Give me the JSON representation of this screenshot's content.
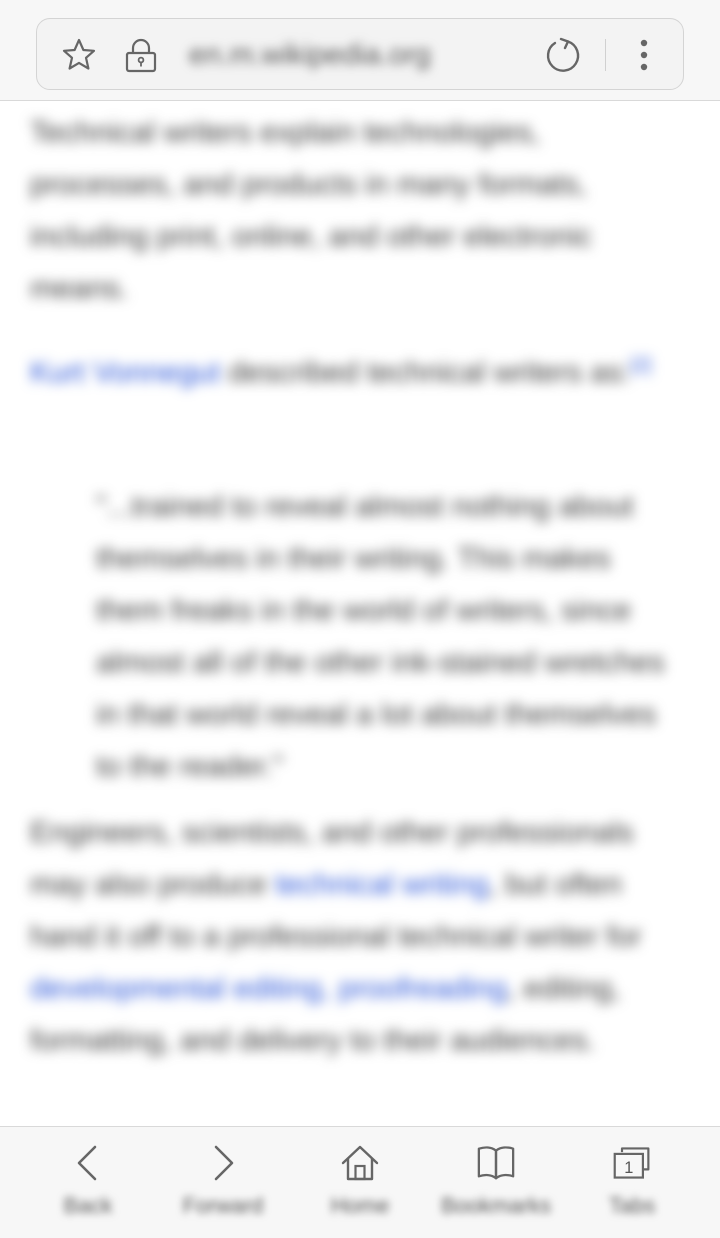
{
  "browser": {
    "url": "en.m.wikipedia.org"
  },
  "icons": {
    "star": "star-icon",
    "lock": "lock-icon",
    "reload": "reload-icon",
    "menu": "more-vertical-icon",
    "back": "chevron-left-icon",
    "forward": "chevron-right-icon",
    "home": "home-icon",
    "bookmarks": "book-icon",
    "tabs": "tabs-icon"
  },
  "article": {
    "p1": "Technical writers explain technologies, processes, and products in many formats, including print, online, and other electronic means.",
    "p2_link": "Kurt Vonnegut",
    "p2_text": " described technical writers as:",
    "p2_ref": "[2]",
    "quote": "\"...trained to reveal almost nothing about themselves in their writing. This makes them freaks in the world of writers, since almost all of the other ink-stained wretches in that world reveal a lot about themselves to the reader.\"",
    "p3_a": "Engineers, scientists, and other professionals may also produce ",
    "p3_link1": "technical writing",
    "p3_b": ", but often hand it off to a professional technical writer for ",
    "p3_link2": "developmental editing, proofreading",
    "p3_c": ", editing, formatting, and delivery to their audiences."
  },
  "bottom_nav": {
    "back": "Back",
    "forward": "Forward",
    "home": "Home",
    "bookmarks": "Bookmarks",
    "tabs": "Tabs",
    "tab_count": "1"
  },
  "colors": {
    "link": "#2a55d8",
    "text": "#3a3a3a",
    "bar_background": "#f7f7f7",
    "icon": "#666666"
  }
}
